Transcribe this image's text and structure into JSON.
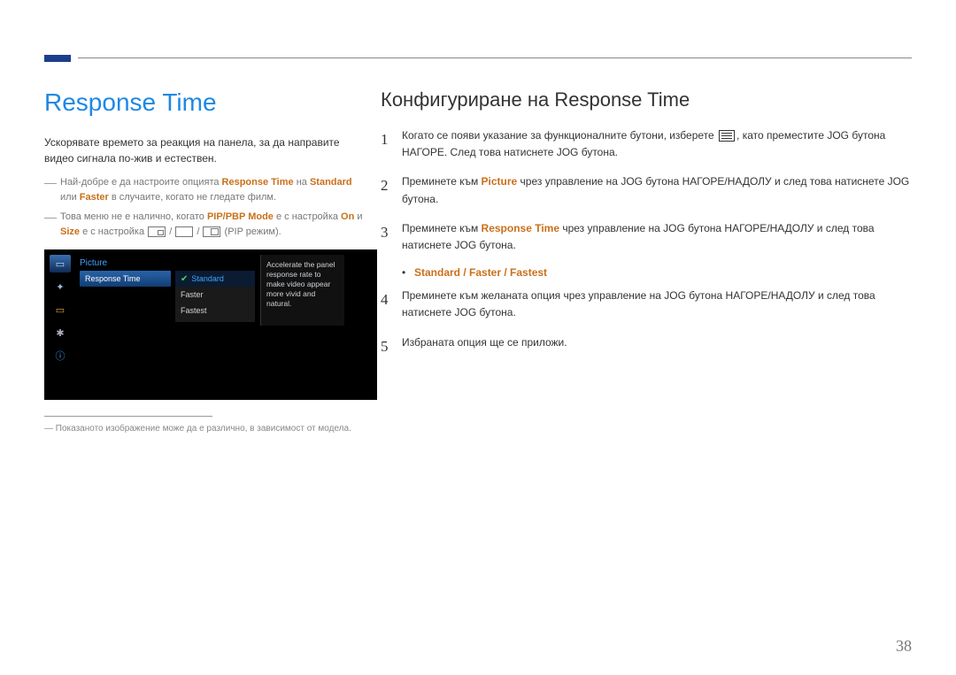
{
  "page_number": "38",
  "left": {
    "title": "Response Time",
    "intro": "Ускорявате времето за реакция на панела, за да направите видео сигнала по-жив и естествен.",
    "tip1_pre": "Най-добре е да настроите опцията ",
    "tip1_rt": "Response Time",
    "tip1_mid": " на ",
    "tip1_std": "Standard",
    "tip1_mid2": " или ",
    "tip1_faster": "Faster",
    "tip1_post": " в случаите, когато не гледате филм.",
    "tip2_pre": "Това меню не е налично, когато ",
    "tip2_pip": "PIP/PBP Mode",
    "tip2_mid": " е с настройка ",
    "tip2_on": "On",
    "tip2_mid2": " и ",
    "tip2_size": "Size",
    "tip2_mid3": " е с настройка ",
    "tip2_post": " (PIP режим).",
    "osd": {
      "title": "Picture",
      "menu_item": "Response Time",
      "opt1": "Standard",
      "opt2": "Faster",
      "opt3": "Fastest",
      "desc": "Accelerate the panel response rate to make video appear more vivid and natural."
    },
    "note": "Показаното изображение може да е различно, в зависимост от модела."
  },
  "right": {
    "title": "Конфигуриране на Response Time",
    "step1_a": "Когато се появи указание за функционалните бутони, изберете ",
    "step1_b": ", като преместите JOG бутона НАГОРЕ. След това натиснете JOG бутона.",
    "step2_a": "Преминете към ",
    "step2_pic": "Picture",
    "step2_b": " чрез управление на JOG бутона НАГОРЕ/НАДОЛУ и след това натиснете JOG бутона.",
    "step3_a": "Преминете към ",
    "step3_rt": "Response Time",
    "step3_b": " чрез управление на JOG бутона НАГОРЕ/НАДОЛУ и след това натиснете JOG бутона.",
    "bullet": "Standard / Faster / Fastest",
    "step4": "Преминете към желаната опция чрез управление на JOG бутона НАГОРЕ/НАДОЛУ и след това натиснете JOG бутона.",
    "step5": "Избраната опция ще се приложи."
  }
}
